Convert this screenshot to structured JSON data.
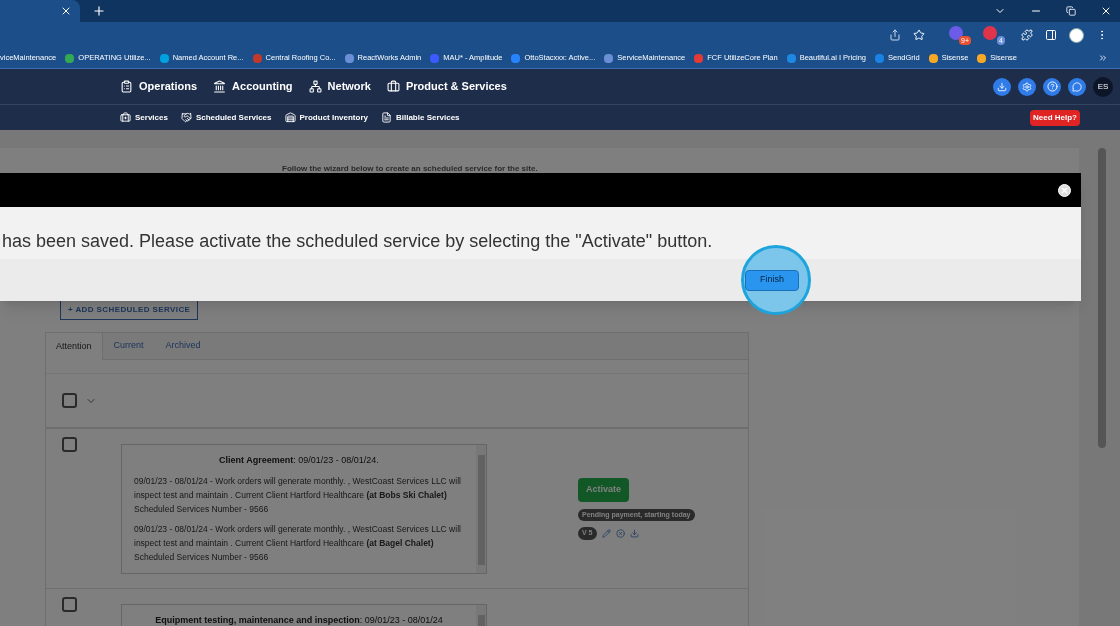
{
  "browser": {
    "extension_badges": [
      "9+",
      "4"
    ],
    "bookmarks": [
      "viceMaintenance",
      "OPERATING Utilize...",
      "Named Account Re...",
      "Central Roofing Co...",
      "ReactWorks Admin",
      "MAU* - Amplitude",
      "OttoStacxxx: Active...",
      "ServiceMaintenance",
      "FCF UtilizeCore Plan",
      "Beautiful.ai I Pricing",
      "SendGrid",
      "Sisense",
      "Sisense"
    ]
  },
  "app_nav": {
    "menu": [
      "Operations",
      "Accounting",
      "Network",
      "Product & Services"
    ],
    "avatar": "ES",
    "submenu": [
      "Services",
      "Scheduled Services",
      "Product Inventory",
      "Billable Services"
    ],
    "help_button": "Need Help?"
  },
  "page": {
    "intro": "Follow the wizard below to create an scheduled service for the site.",
    "add_button": "+ ADD SCHEDULED SERVICE",
    "tabs": [
      {
        "label": "Attention",
        "selected": true
      },
      {
        "label": "Current",
        "selected": false
      },
      {
        "label": "Archived",
        "selected": false
      }
    ],
    "select_all": {
      "checked": false
    },
    "agreements": [
      {
        "checked": false,
        "title": "Client Agreement",
        "dates": ": 09/01/23 - 08/01/24.",
        "paragraphs": [
          "09/01/23 - 08/01/24 - Work orders will generate monthly. , WestCoast Services LLC will inspect test and maintain . Current Client Hartford Healthcare **(at Bobs Ski Chalet)** Scheduled Services Number - 9566",
          "09/01/23 - 08/01/24 - Work orders will generate monthly. , WestCoast Services LLC will inspect test and maintain . Current Client Hartford Healthcare **(at Bagel Chalet)** Scheduled Services Number - 9566"
        ],
        "activate_button": "Activate",
        "status": "Pending payment, starting today",
        "version": "V 5"
      },
      {
        "checked": false,
        "title": "Equipment testing, maintenance and inspection",
        "dates": ": 09/01/23 - 08/01/24"
      }
    ]
  },
  "modal": {
    "message": "has been saved. Please activate the scheduled service by selecting the \"Activate\" button.",
    "finish_button": "Finish"
  }
}
